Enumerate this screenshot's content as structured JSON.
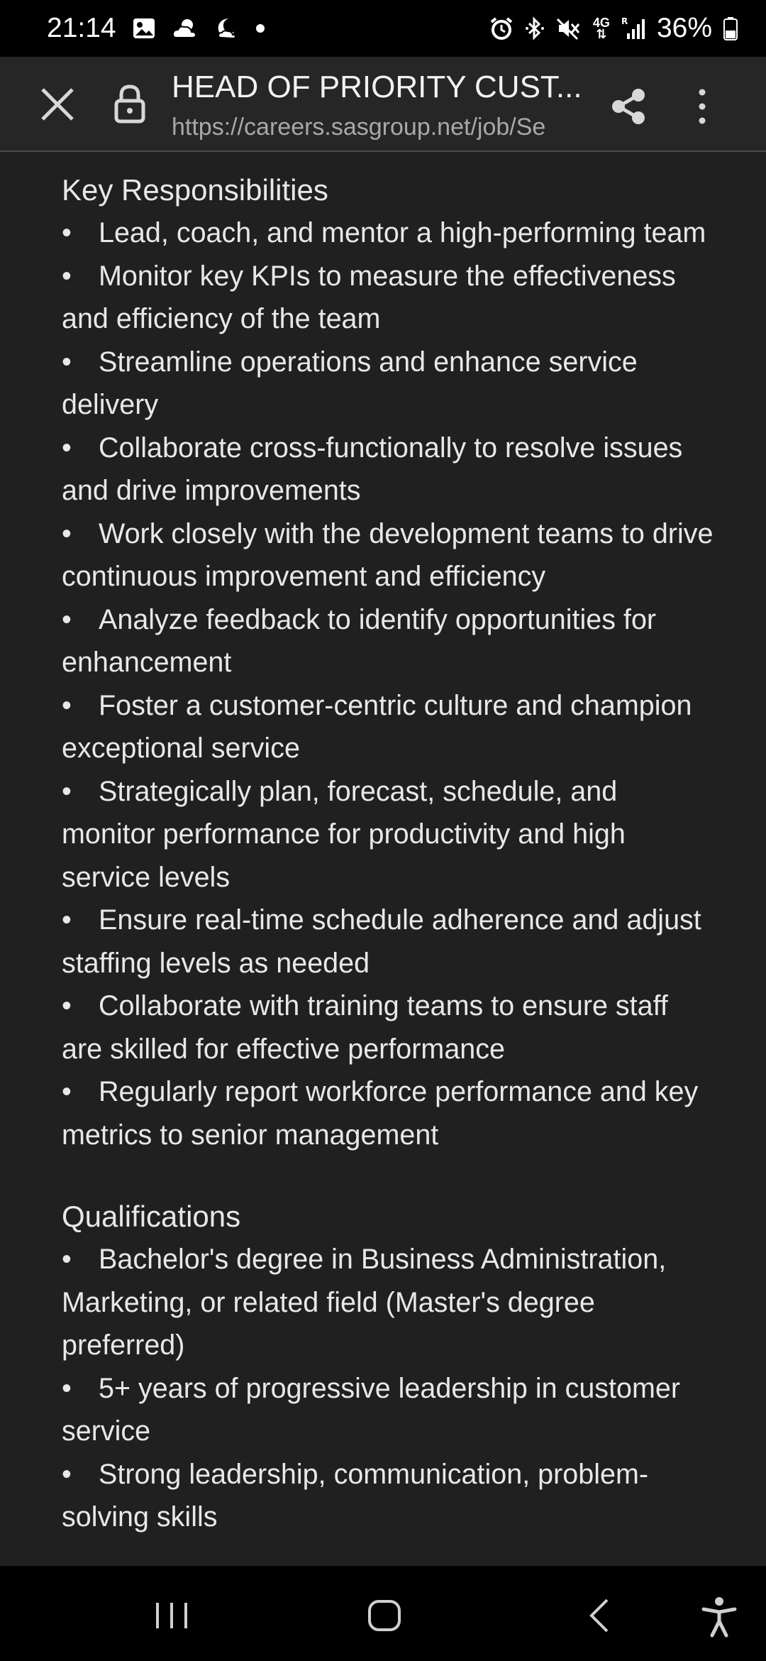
{
  "status_bar": {
    "time": "21:14",
    "notification_icons": [
      "image-icon",
      "weather-icon",
      "night-icon",
      "dot-icon"
    ],
    "system_icons": [
      "alarm-icon",
      "bluetooth-icon",
      "mute-icon",
      "4g-data-icon",
      "signal-icon"
    ],
    "network_top": "4G",
    "network_bottom": "R",
    "battery_percent": "36%"
  },
  "toolbar": {
    "title": "HEAD OF PRIORITY CUST...",
    "url": "https://careers.sasgroup.net/job/Se",
    "icons": [
      "close-icon",
      "lock-icon",
      "share-icon",
      "more-options-icon"
    ]
  },
  "content": {
    "bullet_char": "•",
    "responsibilities": {
      "title": "Key Responsibilities",
      "items": [
        "Lead, coach, and mentor a high-performing team",
        "Monitor key KPIs to measure the effectiveness and efficiency of the team",
        "Streamline operations and enhance service delivery",
        "Collaborate cross-functionally to resolve issues and drive improvements",
        "Work closely with the development teams to drive continuous improvement and efficiency",
        "Analyze feedback to identify opportunities for enhancement",
        "Foster a customer-centric culture and champion exceptional service",
        "Strategically plan, forecast, schedule, and monitor performance for productivity and high service levels",
        "Ensure real-time schedule adherence and adjust staffing levels as needed",
        "Collaborate with training teams to ensure staff are skilled for effective performance",
        "Regularly report workforce performance and key metrics to senior management"
      ]
    },
    "qualifications": {
      "title": "Qualifications",
      "items": [
        "Bachelor's degree in Business Administration, Marketing, or related field (Master's degree preferred)",
        "5+ years of progressive leadership in customer service",
        "Strong leadership, communication, problem-solving skills"
      ]
    }
  },
  "nav_bar": {
    "icons": [
      "recent-apps-icon",
      "home-icon",
      "back-icon",
      "accessibility-icon"
    ]
  }
}
